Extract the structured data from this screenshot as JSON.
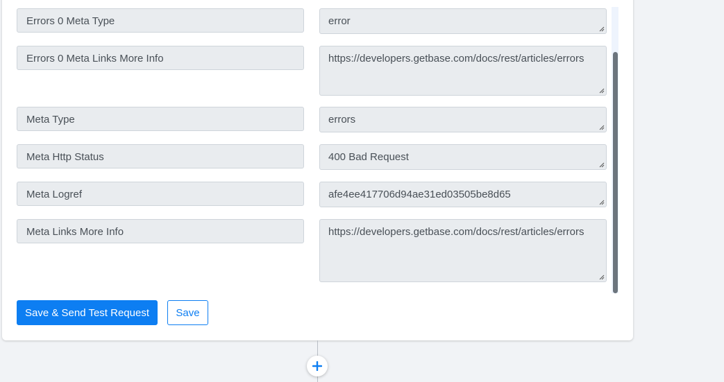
{
  "fields": [
    {
      "label": "Errors 0 Meta Type",
      "value": "error"
    },
    {
      "label": "Errors 0 Meta Links More Info",
      "value": "https://developers.getbase.com/docs/rest/articles/errors"
    },
    {
      "label": "Meta Type",
      "value": "errors"
    },
    {
      "label": "Meta Http Status",
      "value": "400 Bad Request"
    },
    {
      "label": "Meta Logref",
      "value": "afe4ee417706d94ae31ed03505be8d65"
    },
    {
      "label": "Meta Links More Info",
      "value": "https://developers.getbase.com/docs/rest/articles/errors"
    }
  ],
  "actions": {
    "save_send_label": "Save & Send Test Request",
    "save_label": "Save"
  },
  "colors": {
    "accent": "#0d7ef2",
    "field_bg": "#e9ecef",
    "scrollbar": "#6c757d"
  },
  "icons": {
    "add_step": "plus-icon",
    "resize": "resize-grip-icon"
  }
}
